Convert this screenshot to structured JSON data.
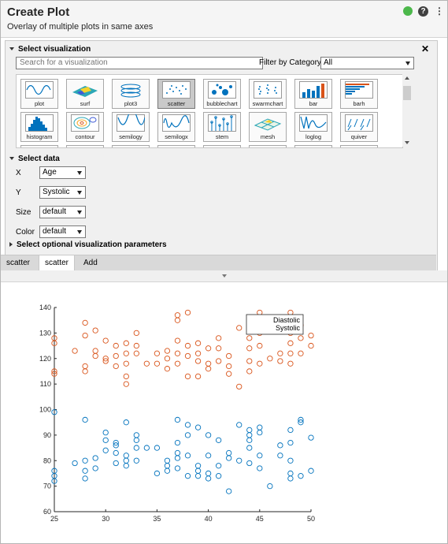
{
  "app": {
    "title": "Create Plot",
    "subtitle": "Overlay of multiple plots in same axes",
    "header_icons": [
      "status-green-dot",
      "help-icon",
      "more-options-icon"
    ]
  },
  "visualization": {
    "section_label": "Select visualization",
    "search_placeholder": "Search for a visualization",
    "filter_label": "Filter by Category",
    "filter_value": "All",
    "gallery": [
      [
        "plot",
        "surf",
        "plot3",
        "scatter",
        "bubblechart",
        "swarmchart",
        "bar",
        "barh"
      ],
      [
        "histogram",
        "contour",
        "semilogy",
        "semilogx",
        "stem",
        "mesh",
        "loglog",
        "quiver"
      ]
    ],
    "selected": "scatter"
  },
  "data_section": {
    "section_label": "Select data",
    "x_label": "X",
    "x_value": "Age",
    "y_label": "Y",
    "y_value": "Systolic",
    "size_label": "Size",
    "size_value": "default",
    "color_label": "Color",
    "color_value": "default"
  },
  "optional_section": {
    "label": "Select optional visualization parameters"
  },
  "tabs": [
    "scatter",
    "scatter",
    "Add"
  ],
  "colors": {
    "series1": "#0072bd",
    "series2": "#d95319",
    "accent_green": "#4cb84b"
  },
  "chart_data": {
    "type": "scatter",
    "title": "",
    "xlabel": "",
    "ylabel": "",
    "xlim": [
      25,
      50
    ],
    "ylim": [
      60,
      140
    ],
    "xticks": [
      25,
      30,
      35,
      40,
      45,
      50
    ],
    "yticks": [
      60,
      70,
      80,
      90,
      100,
      110,
      120,
      130,
      140
    ],
    "legend_position": "top-right",
    "series": [
      {
        "name": "Diastolic",
        "color": "#0072bd",
        "points": [
          [
            25,
            99
          ],
          [
            25,
            76
          ],
          [
            25,
            74
          ],
          [
            25,
            72
          ],
          [
            27,
            79
          ],
          [
            28,
            96
          ],
          [
            28,
            80
          ],
          [
            28,
            76
          ],
          [
            28,
            73
          ],
          [
            29,
            77
          ],
          [
            29,
            81
          ],
          [
            30,
            91
          ],
          [
            30,
            88
          ],
          [
            30,
            84
          ],
          [
            31,
            87
          ],
          [
            31,
            86
          ],
          [
            31,
            83
          ],
          [
            31,
            79
          ],
          [
            32,
            95
          ],
          [
            32,
            82
          ],
          [
            32,
            80
          ],
          [
            32,
            78
          ],
          [
            33,
            90
          ],
          [
            33,
            88
          ],
          [
            33,
            85
          ],
          [
            33,
            80
          ],
          [
            34,
            85
          ],
          [
            35,
            85
          ],
          [
            35,
            75
          ],
          [
            36,
            80
          ],
          [
            36,
            78
          ],
          [
            36,
            76
          ],
          [
            37,
            96
          ],
          [
            37,
            87
          ],
          [
            37,
            83
          ],
          [
            37,
            81
          ],
          [
            37,
            77
          ],
          [
            38,
            94
          ],
          [
            38,
            90
          ],
          [
            38,
            74
          ],
          [
            38,
            82
          ],
          [
            39,
            93
          ],
          [
            39,
            78
          ],
          [
            39,
            76
          ],
          [
            39,
            74
          ],
          [
            40,
            90
          ],
          [
            40,
            82
          ],
          [
            40,
            75
          ],
          [
            40,
            73
          ],
          [
            41,
            88
          ],
          [
            41,
            78
          ],
          [
            41,
            74
          ],
          [
            42,
            81
          ],
          [
            42,
            68
          ],
          [
            42,
            83
          ],
          [
            43,
            94
          ],
          [
            43,
            80
          ],
          [
            44,
            92
          ],
          [
            44,
            90
          ],
          [
            44,
            88
          ],
          [
            44,
            85
          ],
          [
            44,
            79
          ],
          [
            45,
            93
          ],
          [
            45,
            91
          ],
          [
            45,
            82
          ],
          [
            45,
            77
          ],
          [
            46,
            70
          ],
          [
            47,
            86
          ],
          [
            47,
            82
          ],
          [
            48,
            92
          ],
          [
            48,
            87
          ],
          [
            48,
            80
          ],
          [
            48,
            75
          ],
          [
            48,
            73
          ],
          [
            49,
            96
          ],
          [
            49,
            95
          ],
          [
            49,
            74
          ],
          [
            50,
            89
          ],
          [
            50,
            76
          ]
        ]
      },
      {
        "name": "Systolic",
        "color": "#d95319",
        "points": [
          [
            25,
            128
          ],
          [
            25,
            126
          ],
          [
            25,
            115
          ],
          [
            25,
            114
          ],
          [
            27,
            123
          ],
          [
            28,
            134
          ],
          [
            28,
            129
          ],
          [
            28,
            117
          ],
          [
            28,
            115
          ],
          [
            29,
            131
          ],
          [
            29,
            123
          ],
          [
            29,
            121
          ],
          [
            30,
            127
          ],
          [
            30,
            120
          ],
          [
            30,
            119
          ],
          [
            31,
            125
          ],
          [
            31,
            121
          ],
          [
            31,
            117
          ],
          [
            32,
            126
          ],
          [
            32,
            122
          ],
          [
            32,
            118
          ],
          [
            32,
            113
          ],
          [
            32,
            110
          ],
          [
            33,
            130
          ],
          [
            33,
            125
          ],
          [
            33,
            122
          ],
          [
            34,
            118
          ],
          [
            35,
            122
          ],
          [
            35,
            118
          ],
          [
            36,
            123
          ],
          [
            36,
            120
          ],
          [
            36,
            116
          ],
          [
            37,
            137
          ],
          [
            37,
            135
          ],
          [
            37,
            127
          ],
          [
            37,
            122
          ],
          [
            37,
            118
          ],
          [
            38,
            138
          ],
          [
            38,
            125
          ],
          [
            38,
            121
          ],
          [
            38,
            113
          ],
          [
            39,
            126
          ],
          [
            39,
            122
          ],
          [
            39,
            119
          ],
          [
            39,
            113
          ],
          [
            40,
            124
          ],
          [
            40,
            118
          ],
          [
            40,
            116
          ],
          [
            41,
            128
          ],
          [
            41,
            124
          ],
          [
            41,
            119
          ],
          [
            42,
            121
          ],
          [
            42,
            117
          ],
          [
            42,
            114
          ],
          [
            43,
            132
          ],
          [
            43,
            109
          ],
          [
            44,
            128
          ],
          [
            44,
            124
          ],
          [
            44,
            119
          ],
          [
            44,
            115
          ],
          [
            45,
            138
          ],
          [
            45,
            130
          ],
          [
            45,
            125
          ],
          [
            45,
            118
          ],
          [
            46,
            120
          ],
          [
            47,
            122
          ],
          [
            47,
            119
          ],
          [
            48,
            138
          ],
          [
            48,
            130
          ],
          [
            48,
            126
          ],
          [
            48,
            122
          ],
          [
            48,
            118
          ],
          [
            49,
            133
          ],
          [
            49,
            128
          ],
          [
            49,
            122
          ],
          [
            50,
            129
          ],
          [
            50,
            125
          ]
        ]
      }
    ]
  }
}
